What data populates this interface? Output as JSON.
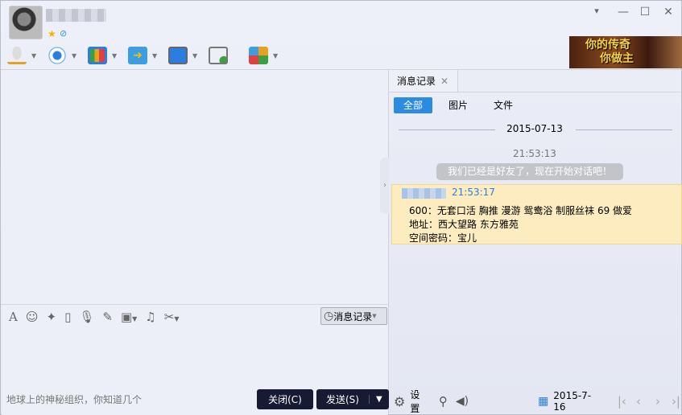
{
  "header": {
    "contact_name": "(blurred)"
  },
  "window_controls": {
    "menu": "▾",
    "minimize": "—",
    "maximize": "☐",
    "close": "✕"
  },
  "toolbar": {
    "items": [
      "voice-call",
      "video-call",
      "screen-share",
      "file-transfer",
      "remote-assist",
      "create-group",
      "apps"
    ]
  },
  "ad": {
    "line1": "你的传奇",
    "line2": "你做主"
  },
  "input_tools": {
    "history_button": "消息记录"
  },
  "signature": "地球上的神秘组织，你知道几个",
  "buttons": {
    "close": "关闭(C)",
    "send": "发送(S)",
    "send_dropdown": "▼"
  },
  "history": {
    "tab_label": "消息记录",
    "filters": [
      "全部",
      "图片",
      "文件"
    ],
    "date": "2015-07-13",
    "system_time": "21:53:13",
    "system_message": "我们已经是好友了，现在开始对话吧！",
    "message": {
      "time": "21:53:17",
      "lines": [
        "600：无套口活 胸推 漫游 鸳鸯浴 制服丝袜 69  做爱",
        "地址：西大望路 东方雅苑",
        "空间密码：宝儿"
      ]
    },
    "bottom": {
      "settings": "设置",
      "current_date": "2015-7-16"
    }
  },
  "colors": {
    "accent": "#2b8be0",
    "highlight": "#fdecc0",
    "button_dark": "#161a33"
  }
}
